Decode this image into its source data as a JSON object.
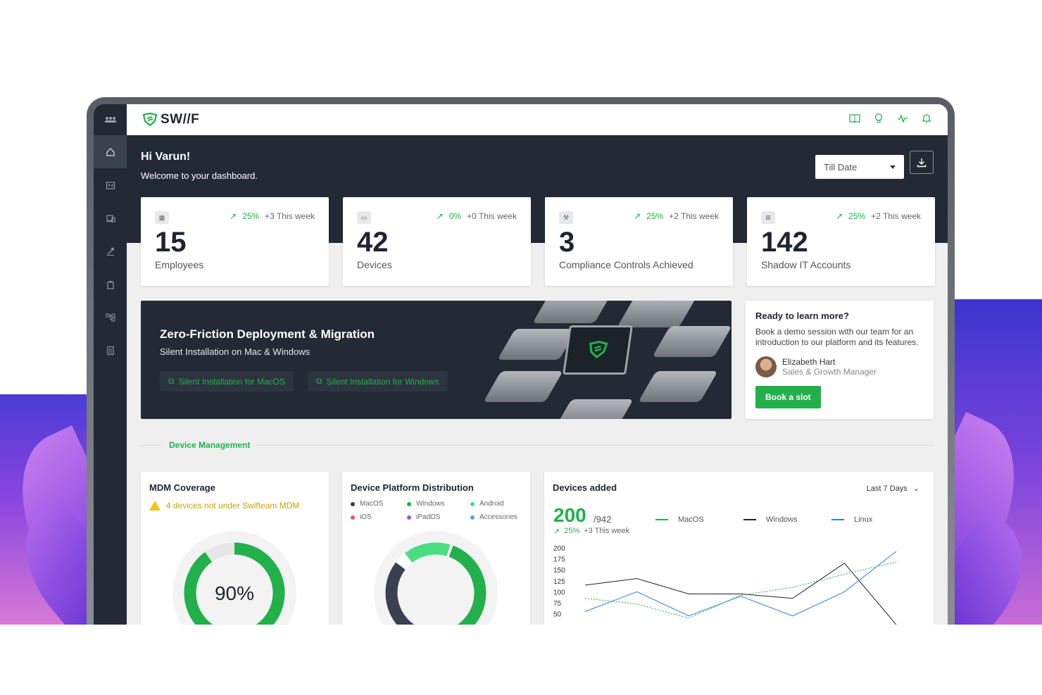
{
  "app": {
    "logo_text": "SW//F",
    "brand_color": "#22b04b",
    "dark_bg": "#232a35"
  },
  "topbar": {
    "icons": [
      "book-icon",
      "lightbulb-icon",
      "activity-icon",
      "bell-icon"
    ]
  },
  "sidebar": {
    "items": [
      "home-icon",
      "employees-icon",
      "devices-icon",
      "compliance-icon",
      "apps-icon",
      "shadow-it-icon",
      "reports-icon"
    ]
  },
  "hero": {
    "greeting": "Hi Varun!",
    "welcome": "Welcome to your dashboard.",
    "filter_value": "Till Date"
  },
  "stats": [
    {
      "value": "15",
      "label": "Employees",
      "pct": "25%",
      "week": "+3 This week"
    },
    {
      "value": "42",
      "label": "Devices",
      "pct": "0%",
      "week": "+0 This week"
    },
    {
      "value": "3",
      "label": "Compliance Controls Achieved",
      "pct": "25%",
      "week": "+2 This week"
    },
    {
      "value": "142",
      "label": "Shadow IT Accounts",
      "pct": "25%",
      "week": "+2 This week"
    }
  ],
  "banner": {
    "title": "Zero-Friction Deployment & Migration",
    "subtitle": "Silent Installation on Mac & Windows",
    "btn_mac": "Silent Installation for MacOS",
    "btn_win": "Silent Installation for Windows"
  },
  "learn": {
    "title": "Ready to learn more?",
    "body": "Book a demo session with our team for an introduction to our platform and its features.",
    "person_name": "Elizabeth Hart",
    "person_role": "Sales & Growth Manager",
    "cta": "Book a slot"
  },
  "section": {
    "label": "Device Management"
  },
  "mdm": {
    "title": "MDM Coverage",
    "warning": "4 devices not under Swifteam MDM",
    "percent_label": "90%",
    "percent": 90
  },
  "platform": {
    "title": "Device Platform Distribution",
    "legend": [
      {
        "name": "MacOS",
        "color": "#3a3f52"
      },
      {
        "name": "Windows",
        "color": "#22b04b"
      },
      {
        "name": "Android",
        "color": "#4ade80"
      },
      {
        "name": "iOS",
        "color": "#f0506e"
      },
      {
        "name": "iPadOS",
        "color": "#9b59d0"
      },
      {
        "name": "Accessories",
        "color": "#5aa0e0"
      }
    ]
  },
  "added": {
    "title": "Devices added",
    "range": "Last 7 Days",
    "value": "200",
    "total": "/942",
    "pct": "25%",
    "week": "+3 This week",
    "legend": [
      {
        "name": "MacOS",
        "color": "#22b04b"
      },
      {
        "name": "Windows",
        "color": "#222222"
      },
      {
        "name": "Linux",
        "color": "#2b7de0"
      }
    ]
  },
  "chart_data": {
    "type": "line",
    "yticks": [
      200,
      175,
      150,
      125,
      100,
      75,
      50
    ],
    "x": [
      1,
      2,
      3,
      4,
      5,
      6,
      7
    ],
    "series": [
      {
        "name": "Windows",
        "values": [
          115,
          130,
          95,
          95,
          85,
          165,
          25
        ]
      },
      {
        "name": "Linux",
        "values": [
          55,
          100,
          45,
          90,
          45,
          100,
          192
        ]
      },
      {
        "name": "MacOS",
        "values": [
          85,
          72,
          40,
          92,
          110,
          140,
          168
        ]
      }
    ]
  }
}
